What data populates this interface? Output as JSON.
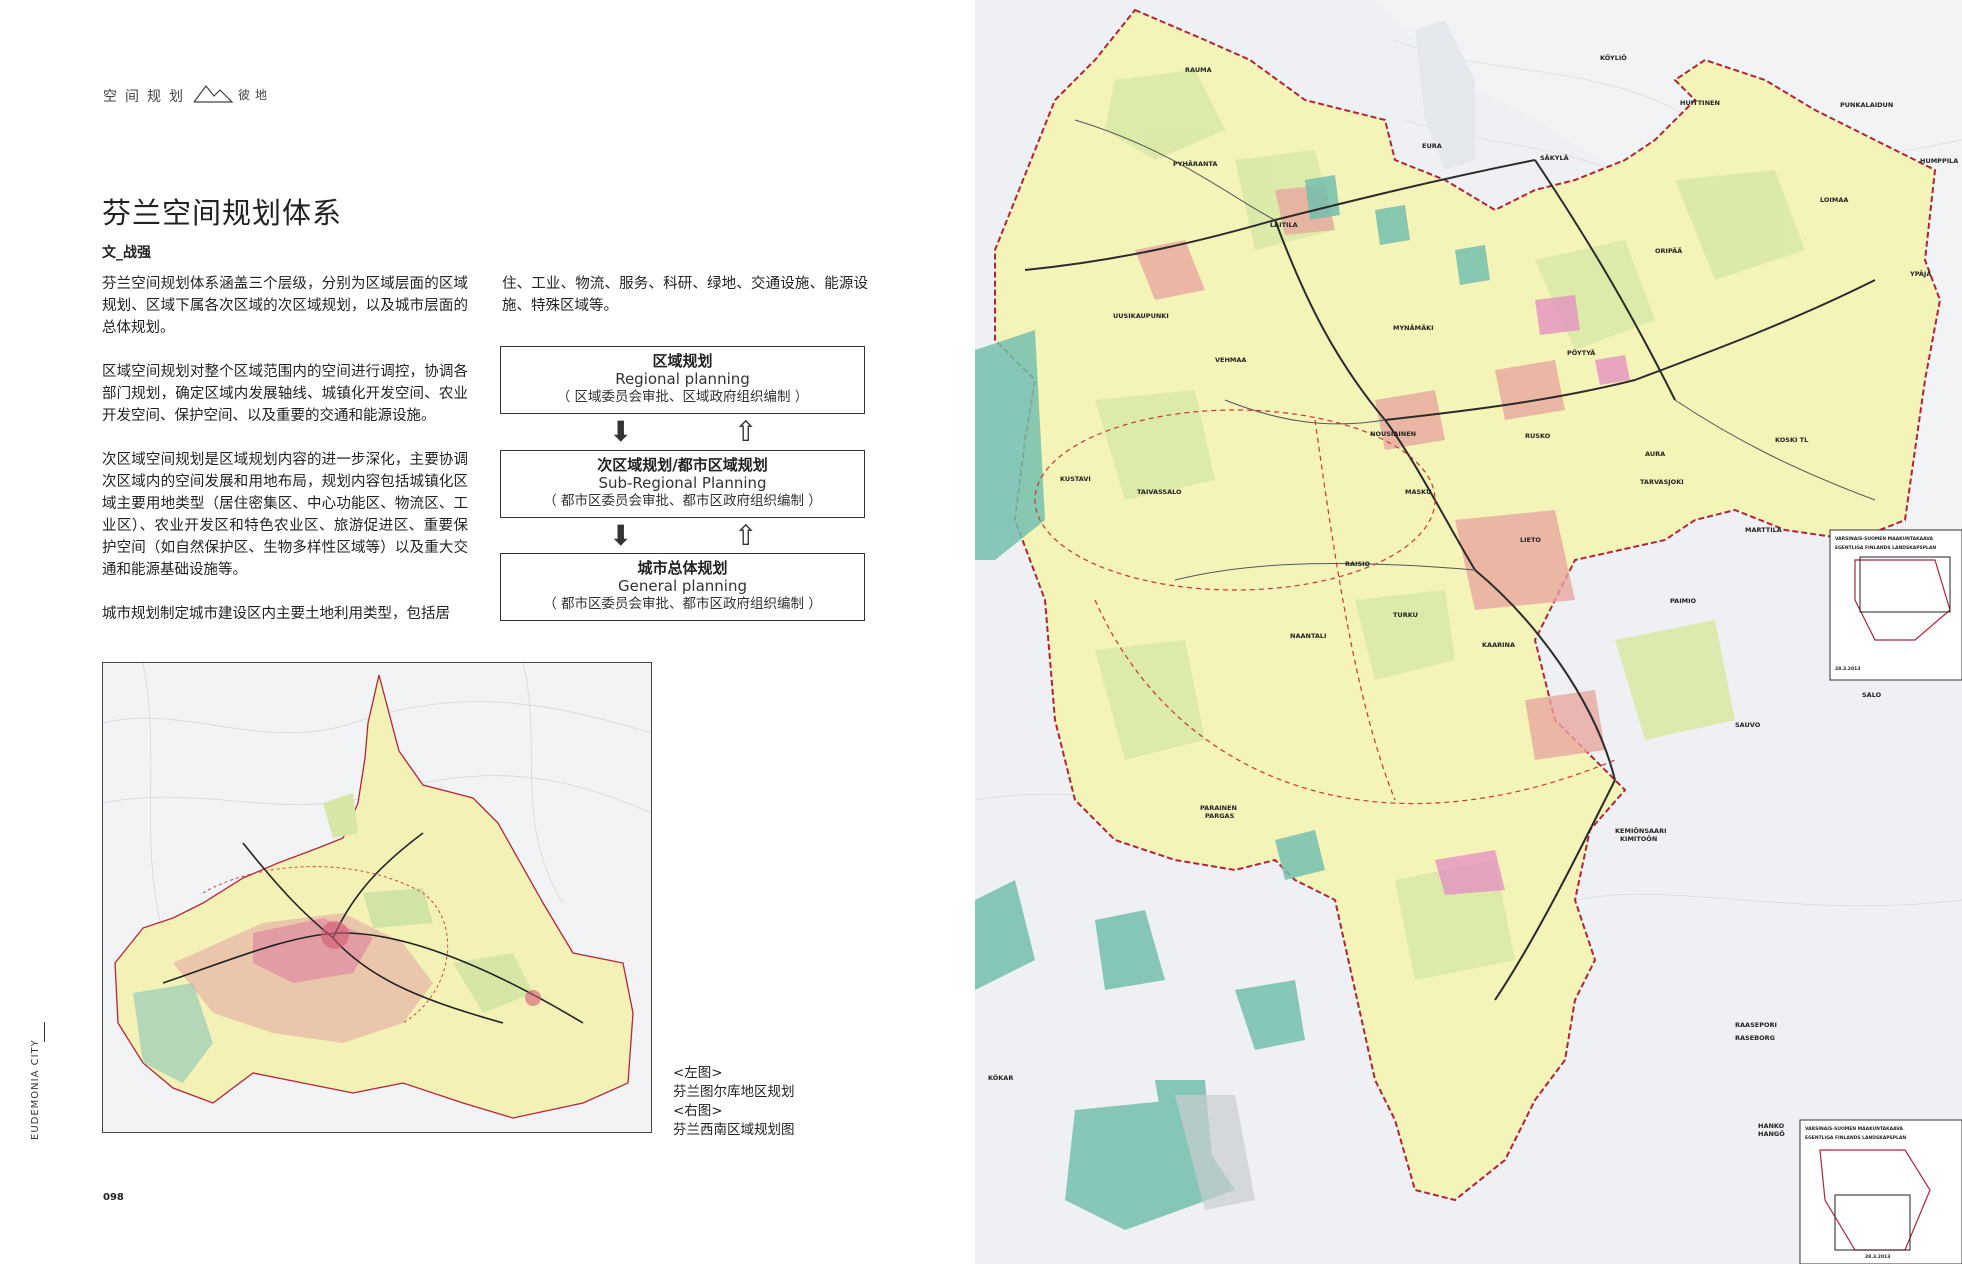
{
  "header": {
    "section_label": "空间规划",
    "logo_text": "彼地"
  },
  "article": {
    "title": "芬兰空间规划体系",
    "author": "文_战强",
    "paragraphs_left": [
      "芬兰空间规划体系涵盖三个层级，分别为区域层面的区域规划、区域下属各次区域的次区域规划，以及城市层面的总体规划。",
      "区域空间规划对整个区域范围内的空间进行调控，协调各部门规划，确定区域内发展轴线、城镇化开发空间、农业开发空间、保护空间、以及重要的交通和能源设施。",
      "次区域空间规划是区域规划内容的进一步深化，主要协调次区域内的空间发展和用地布局，规划内容包括城镇化区域主要用地类型（居住密集区、中心功能区、物流区、工业区）、农业开发区和特色农业区、旅游促进区、重要保护空间（如自然保护区、生物多样性区域等）以及重大交通和能源基础设施等。",
      "城市规划制定城市建设区内主要土地利用类型，包括居"
    ],
    "paragraphs_right": [
      "住、工业、物流、服务、科研、绿地、交通设施、能源设施、特殊区域等。"
    ]
  },
  "diagram": {
    "boxes": [
      {
        "cn": "区域规划",
        "en": "Regional planning",
        "sub": "（ 区域委员会审批、区域政府组织编制 ）"
      },
      {
        "cn": "次区域规划/都市区域规划",
        "en": "Sub-Regional Planning",
        "sub": "（ 都市区委员会审批、都市区政府组织编制 ）"
      },
      {
        "cn": "城市总体规划",
        "en": "General planning",
        "sub": "（ 都市区委员会审批、都市区政府组织编制 ）"
      }
    ],
    "down_arrow": "⬇",
    "up_arrow": "⇧"
  },
  "caption": {
    "line1": "<左图>",
    "line2": "芬兰图尔库地区规划",
    "line3": "<右图>",
    "line4": "芬兰西南区域规划图"
  },
  "footer": {
    "page_number": "098",
    "vertical_text": "EUDEMONIA CITY"
  },
  "map_labels": {
    "rauma": "RAUMA",
    "kokemaki": "KÖYLIÖ",
    "eura": "EURA",
    "sakyla": "SÄKYLÄ",
    "huittinen": "HUITTINEN",
    "punkalaidun": "PUNKALAIDUN",
    "humppila": "HUMPPILA",
    "pyharanta": "PYHÄRANTA",
    "laitila": "LAITILA",
    "loimaa": "LOIMAA",
    "oripaa": "ORIPÄÄ",
    "ypaja": "YPÄJÄ",
    "uusikaupunki": "UUSIKAUPUNKI",
    "mynamaki": "MYNÄMÄKI",
    "vehmaa": "VEHMAA",
    "poytya": "PÖYTYÄ",
    "nousiainen": "NOUSIAINEN",
    "rusko": "RUSKO",
    "aura": "AURA",
    "kustavi": "KUSTAVI",
    "taivassalo": "TAIVASSALO",
    "masku": "MASKU",
    "tarvasjoki": "TARVASJOKI",
    "koski": "KOSKI TL",
    "marttila": "MARTTILA",
    "raisio": "RAISIO",
    "lieto": "LIETO",
    "turku": "TURKU",
    "paimio": "PAIMIO",
    "naantali": "NAANTALI",
    "kaarina": "KAARINA",
    "salo": "SALO",
    "sauvo": "SAUVO",
    "parainen": "PARAINEN",
    "pargas": "PARGAS",
    "kemionsaari": "KEMIÖNSAARI",
    "kimitoon": "KIMITOÖN",
    "raasepori": "RAASEPORI",
    "raseborg": "RASEBORG",
    "kokar": "KÖKAR",
    "hanko": "HANKO",
    "hango": "HANGÖ",
    "inset_title": "VARSINAIS-SUOMEN MAAKUNTAKAAVA",
    "inset_title_sv": "EGENTLIGA FINLANDS LANDSKAPSPLAN",
    "inset_date": "28.3.2013"
  },
  "colors": {
    "map_sea": "#eef0f3",
    "map_land": "#f4f3b8",
    "map_forest": "#d9e9a8",
    "map_water_teal": "#74bfae",
    "map_border_red": "#b0243a",
    "map_road": "#2b2b2b",
    "map_urban": "#e8a7a0",
    "map_pink": "#e48cc3"
  }
}
